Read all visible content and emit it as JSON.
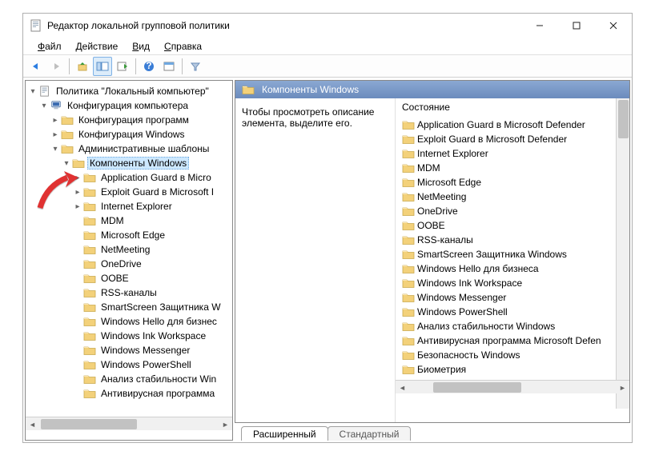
{
  "window": {
    "title": "Редактор локальной групповой политики"
  },
  "menu": {
    "file": "Файл",
    "action": "Действие",
    "view": "Вид",
    "help": "Справка"
  },
  "tree": {
    "root": "Политика \"Локальный компьютер\"",
    "computer_config": "Конфигурация компьютера",
    "software": "Конфигурация программ",
    "windows": "Конфигурация Windows",
    "admin_templates": "Административные шаблоны",
    "windows_components": "Компоненты Windows",
    "children": [
      "Application Guard в Micro",
      "Exploit Guard в Microsoft I",
      "Internet Explorer",
      "MDM",
      "Microsoft Edge",
      "NetMeeting",
      "OneDrive",
      "OOBE",
      "RSS-каналы",
      "SmartScreen Защитника W",
      "Windows Hello для бизнес",
      "Windows Ink Workspace",
      "Windows Messenger",
      "Windows PowerShell",
      "Анализ стабильности Win",
      "Антивирусная программа"
    ]
  },
  "right": {
    "header": "Компоненты Windows",
    "hint": "Чтобы просмотреть описание элемента, выделите его.",
    "column": "Состояние",
    "items": [
      "Application Guard в Microsoft Defender",
      "Exploit Guard в Microsoft Defender",
      "Internet Explorer",
      "MDM",
      "Microsoft Edge",
      "NetMeeting",
      "OneDrive",
      "OOBE",
      "RSS-каналы",
      "SmartScreen Защитника Windows",
      "Windows Hello для бизнеса",
      "Windows Ink Workspace",
      "Windows Messenger",
      "Windows PowerShell",
      "Анализ стабильности Windows",
      "Антивирусная программа Microsoft Defen",
      "Безопасность Windows",
      "Биометрия"
    ]
  },
  "tabs": {
    "extended": "Расширенный",
    "standard": "Стандартный"
  }
}
